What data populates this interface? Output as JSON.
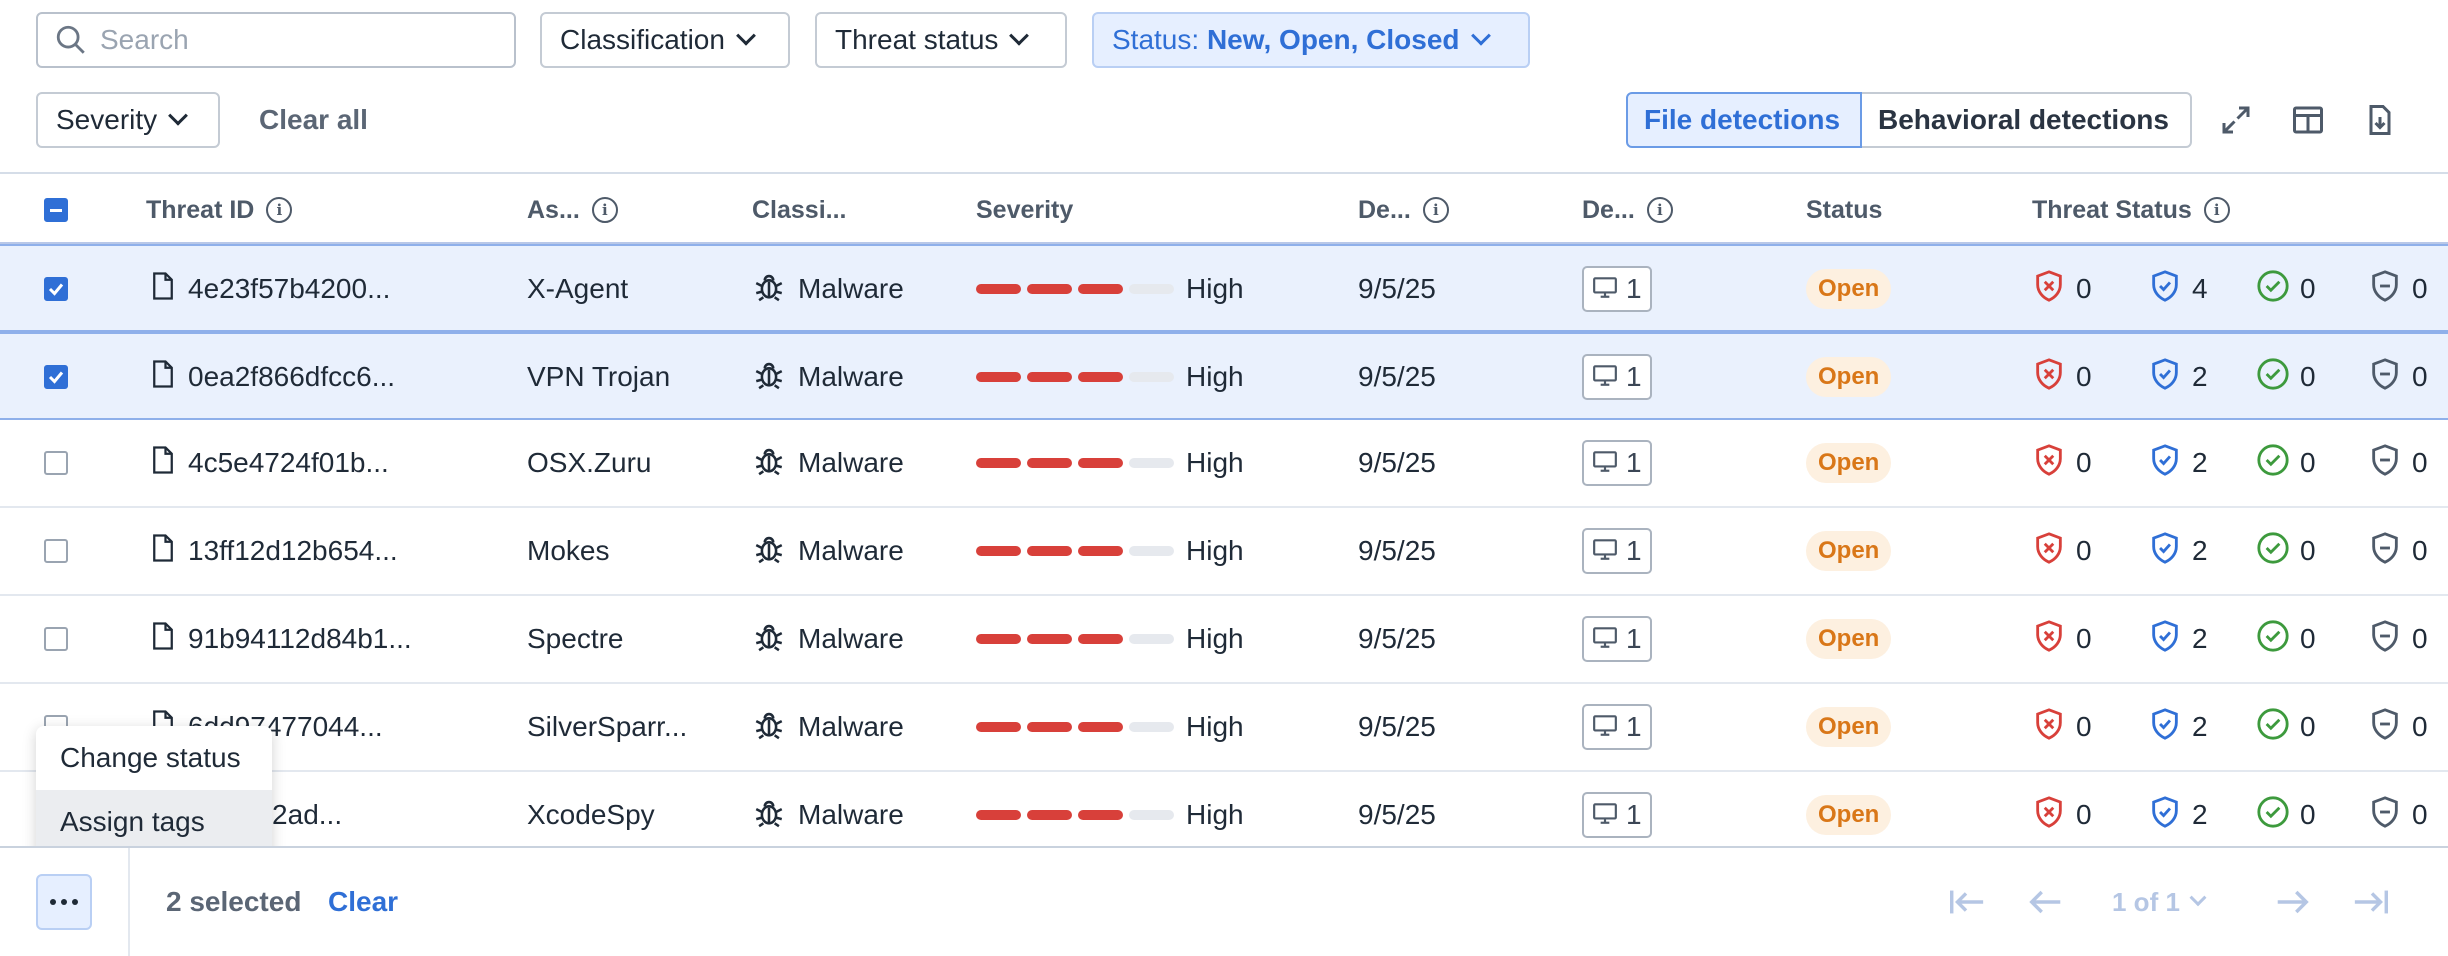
{
  "filters": {
    "search_placeholder": "Search",
    "classification": "Classification",
    "threat_status": "Threat status",
    "status_prefix": "Status:",
    "status_value": "New, Open, Closed",
    "severity": "Severity",
    "clear_all": "Clear all"
  },
  "view_toggle": {
    "file": "File detections",
    "behavioral": "Behavioral detections"
  },
  "columns": {
    "threat_id": "Threat ID",
    "asset": "As...",
    "classification": "Classi...",
    "severity": "Severity",
    "detected": "De...",
    "devices": "De...",
    "status": "Status",
    "threat_status": "Threat Status"
  },
  "rows": [
    {
      "checked": true,
      "id": "4e23f57b4200...",
      "name": "X-Agent",
      "class": "Malware",
      "sev_level": 3,
      "sev_label": "High",
      "date": "9/5/25",
      "devices": "1",
      "status": "Open",
      "ts": [
        "0",
        "4",
        "0",
        "0"
      ]
    },
    {
      "checked": true,
      "id": "0ea2f866dfcc6...",
      "name": "VPN Trojan",
      "class": "Malware",
      "sev_level": 3,
      "sev_label": "High",
      "date": "9/5/25",
      "devices": "1",
      "status": "Open",
      "ts": [
        "0",
        "2",
        "0",
        "0"
      ]
    },
    {
      "checked": false,
      "id": "4c5e4724f01b...",
      "name": "OSX.Zuru",
      "class": "Malware",
      "sev_level": 3,
      "sev_label": "High",
      "date": "9/5/25",
      "devices": "1",
      "status": "Open",
      "ts": [
        "0",
        "2",
        "0",
        "0"
      ]
    },
    {
      "checked": false,
      "id": "13ff12d12b654...",
      "name": "Mokes",
      "class": "Malware",
      "sev_level": 3,
      "sev_label": "High",
      "date": "9/5/25",
      "devices": "1",
      "status": "Open",
      "ts": [
        "0",
        "2",
        "0",
        "0"
      ]
    },
    {
      "checked": false,
      "id": "91b94112d84b1...",
      "name": "Spectre",
      "class": "Malware",
      "sev_level": 3,
      "sev_label": "High",
      "date": "9/5/25",
      "devices": "1",
      "status": "Open",
      "ts": [
        "0",
        "2",
        "0",
        "0"
      ]
    },
    {
      "checked": false,
      "id": "6dd97477044...",
      "name": "SilverSparr...",
      "class": "Malware",
      "sev_level": 3,
      "sev_label": "High",
      "date": "9/5/25",
      "devices": "1",
      "status": "Open",
      "ts": [
        "0",
        "2",
        "0",
        "0"
      ]
    },
    {
      "checked": false,
      "id": "...24c62ad...",
      "name": "XcodeSpy",
      "class": "Malware",
      "sev_level": 3,
      "sev_label": "High",
      "date": "9/5/25",
      "devices": "1",
      "status": "Open",
      "ts": [
        "0",
        "2",
        "0",
        "0"
      ]
    }
  ],
  "menu": {
    "change_status": "Change status",
    "assign_tags": "Assign tags"
  },
  "footer": {
    "selected": "2 selected",
    "clear": "Clear",
    "page": "1 of 1"
  },
  "colors": {
    "accent": "#2f6fd6",
    "severity_high": "#d8403a",
    "open_pill": "#d97718",
    "ts_red": "#d8403a",
    "ts_blue": "#2f6fd6",
    "ts_green": "#3d9a3d",
    "ts_gray": "#4e5a69"
  }
}
